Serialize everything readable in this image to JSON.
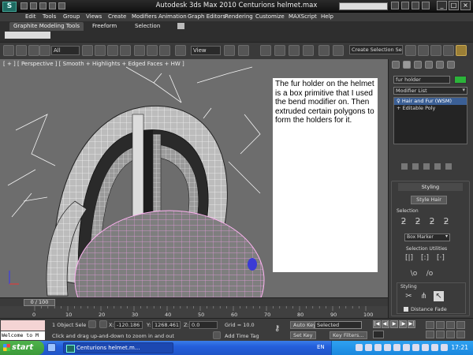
{
  "window": {
    "title": "Autodesk 3ds Max  2010      Centurions helmet.max"
  },
  "menu": [
    "Edit",
    "Tools",
    "Group",
    "Views",
    "Create",
    "Modifiers",
    "Animation",
    "Graph Editors",
    "Rendering",
    "Customize",
    "MAXScript",
    "Help"
  ],
  "ribbon": {
    "tabs": [
      "Graphite Modeling Tools",
      "Freeform",
      "Selection"
    ]
  },
  "toolbar": {
    "selection_filter": "All",
    "reference_coord": "View",
    "named_selection": "Create Selection Se"
  },
  "viewport": {
    "label": "[ + ] [ Perspective ] [ Smooth + Highlights + Edged Faces + HW ]",
    "note": "The fur holder on the helmet is a box primitive that I used the bend modifier on. Then extruded certain polygons to form the holders for it."
  },
  "command_panel": {
    "object_name": "fur holder",
    "object_color": "#2bb43a",
    "modifier_list": "Modifier List",
    "stack": [
      "Hair and Fur (WSM)",
      "Editable Poly"
    ],
    "rollout_title": "Styling",
    "style_hair_button": "Style Hair",
    "selection_group": "Selection",
    "box_marker": "Box Marker",
    "selection_utilities": "Selection Utilities",
    "styling_group": "Styling",
    "distance_fade": "Distance Fade"
  },
  "timeline": {
    "thumb": "0 / 100",
    "ticks": [
      "0",
      "10",
      "20",
      "30",
      "40",
      "50",
      "60",
      "70",
      "80",
      "90",
      "100"
    ]
  },
  "status": {
    "maxscript_listener": "Welcome to M",
    "selected_count": "1 Object Sele",
    "x_label": "X:",
    "x_value": "-120.186",
    "y_label": "Y:",
    "y_value": "1268.461",
    "z_label": "Z:",
    "z_value": "0.0",
    "grid": "Grid = 10.0",
    "auto_key": "Auto Key",
    "set_key": "Set Key",
    "key_mode": "Selected",
    "key_filters": "Key Filters...",
    "prompt": "Click and drag up-and-down to zoom in and out",
    "add_time_tag": "Add Time Tag"
  },
  "taskbar": {
    "start": "start",
    "task": "Centurions helmet.m...",
    "language": "EN",
    "clock": "17:21"
  }
}
